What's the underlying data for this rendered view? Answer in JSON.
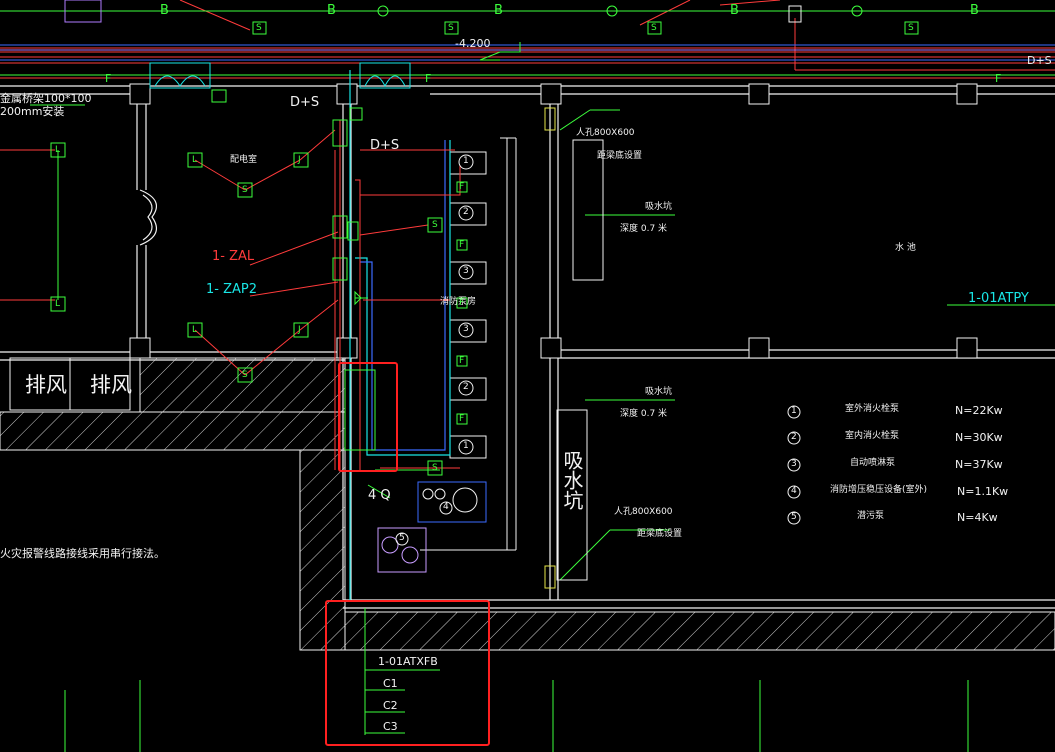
{
  "drawing": {
    "top_labels": [
      "B",
      "B",
      "B",
      "B",
      "B"
    ],
    "elevation": "-4.200",
    "f_labels": [
      "F",
      "F",
      "F"
    ],
    "ds_right": "D+S",
    "tray_note_1": "金属桥架100*100",
    "tray_note_2": "200mm安装",
    "ds_label_1": "D+S",
    "ds_label_2": "D+S",
    "room_power": "配电室",
    "room_pump": "消防泵房",
    "zal": "1- ZAL",
    "zap2": "1- ZAP2",
    "exhaust_1": "排风",
    "exhaust_2": "排风",
    "manhole_1": "人孔800X600",
    "manhole_1_note": "距梁底设置",
    "manhole_2": "人孔800X600",
    "manhole_2_note": "距梁底设置",
    "sump_1": "吸水坑",
    "sump_1_depth": "深度 0.7  米",
    "sump_2": "吸水坑",
    "sump_2_depth": "深度 0.7  米",
    "sump_vertical": "吸水坑",
    "pool": "水  池",
    "atpy": "1-01ATPY",
    "fire_alarm_note": "火灾报警线路接线采用串行接法。",
    "conduit_4q": "4 Q",
    "atxfb": "1-01ATXFB",
    "feeders": [
      "C1",
      "C2",
      "C3"
    ],
    "symbol_L": "L",
    "symbol_S": "S",
    "symbol_J": "J",
    "symbol_F": "F"
  },
  "legend": [
    {
      "num": "1",
      "name": "室外消火栓泵",
      "power": "N=22Kw"
    },
    {
      "num": "2",
      "name": "室内消火栓泵",
      "power": "N=30Kw"
    },
    {
      "num": "3",
      "name": "自动喷淋泵",
      "power": "N=37Kw"
    },
    {
      "num": "4",
      "name": "消防增压稳压设备(室外)",
      "power": "N=1.1Kw"
    },
    {
      "num": "5",
      "name": "潜污泵",
      "power": "N=4Kw"
    }
  ],
  "pump_numbers": [
    "1",
    "2",
    "3",
    "3",
    "2",
    "1"
  ],
  "colors": {
    "background": "#000000",
    "wall": "#f2f2f2",
    "green": "#3cff3c",
    "red": "#ff3b3b",
    "cyan": "#19e6e6",
    "blue": "#3b6bff",
    "magenta": "#b07cff",
    "highlight": "#ff2020"
  }
}
